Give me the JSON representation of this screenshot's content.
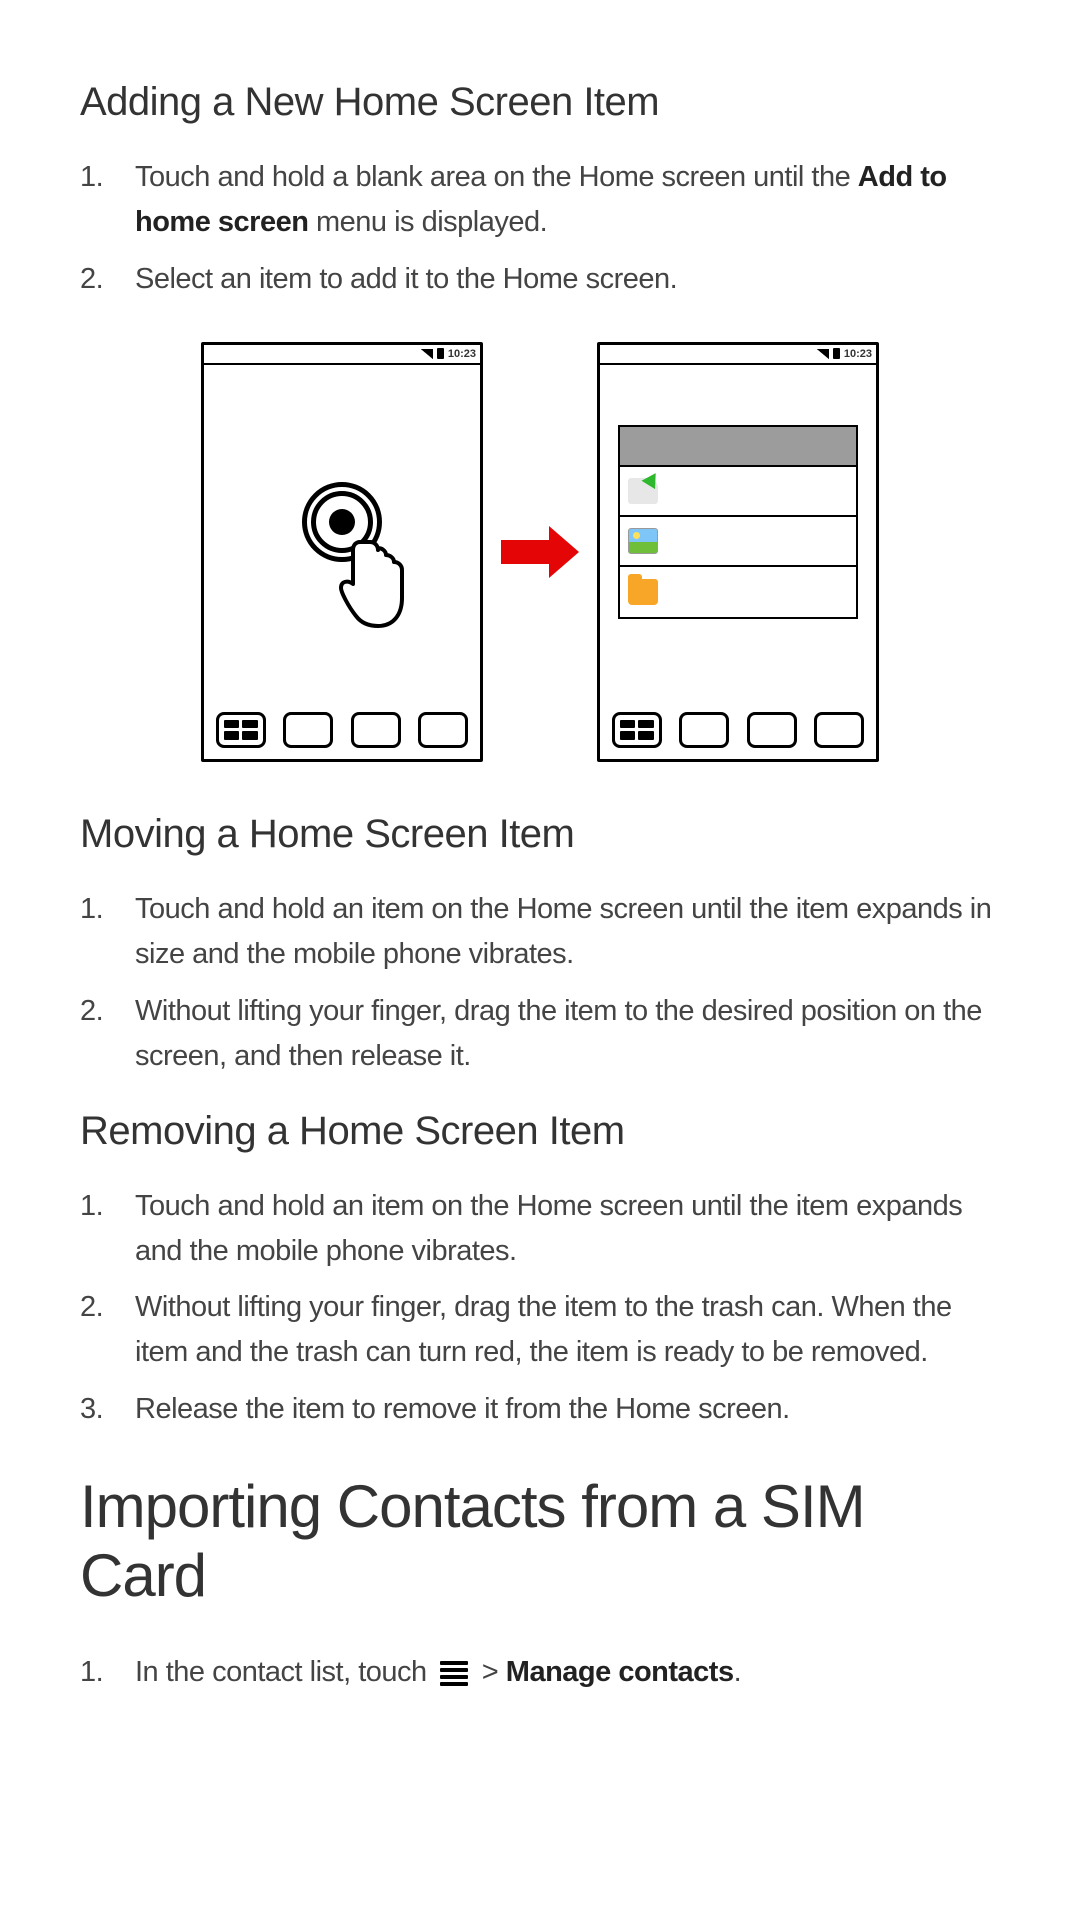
{
  "sections": {
    "add": {
      "title": "Adding a New Home Screen Item",
      "steps": [
        {
          "pre": "Touch and hold a blank area on the Home screen until the ",
          "bold": "Add to home screen",
          "post": " menu is displayed."
        },
        {
          "text": "Select an item to add it to the Home screen."
        }
      ]
    },
    "move": {
      "title": "Moving a Home Screen Item",
      "steps": [
        {
          "text": "Touch and hold an item on the Home screen until the item expands in size and the mobile phone vibrates."
        },
        {
          "text": "Without lifting your finger, drag the item to the desired position on the screen, and then release it."
        }
      ]
    },
    "remove": {
      "title": "Removing a Home Screen Item",
      "steps": [
        {
          "text": "Touch and hold an item on the Home screen until the item expands and the mobile phone vibrates."
        },
        {
          "text": "Without lifting your finger, drag the item to the trash can. When the item and the trash can turn red, the item is ready to be removed."
        },
        {
          "text": "Release the item to remove it from the Home screen."
        }
      ]
    },
    "import": {
      "title": "Importing Contacts from a SIM Card",
      "steps": [
        {
          "pre": "In the contact list, touch ",
          "icon": "menu",
          "mid": " > ",
          "bold": "Manage contacts",
          "post": "."
        }
      ]
    }
  },
  "figure": {
    "status_time": "10:23"
  }
}
